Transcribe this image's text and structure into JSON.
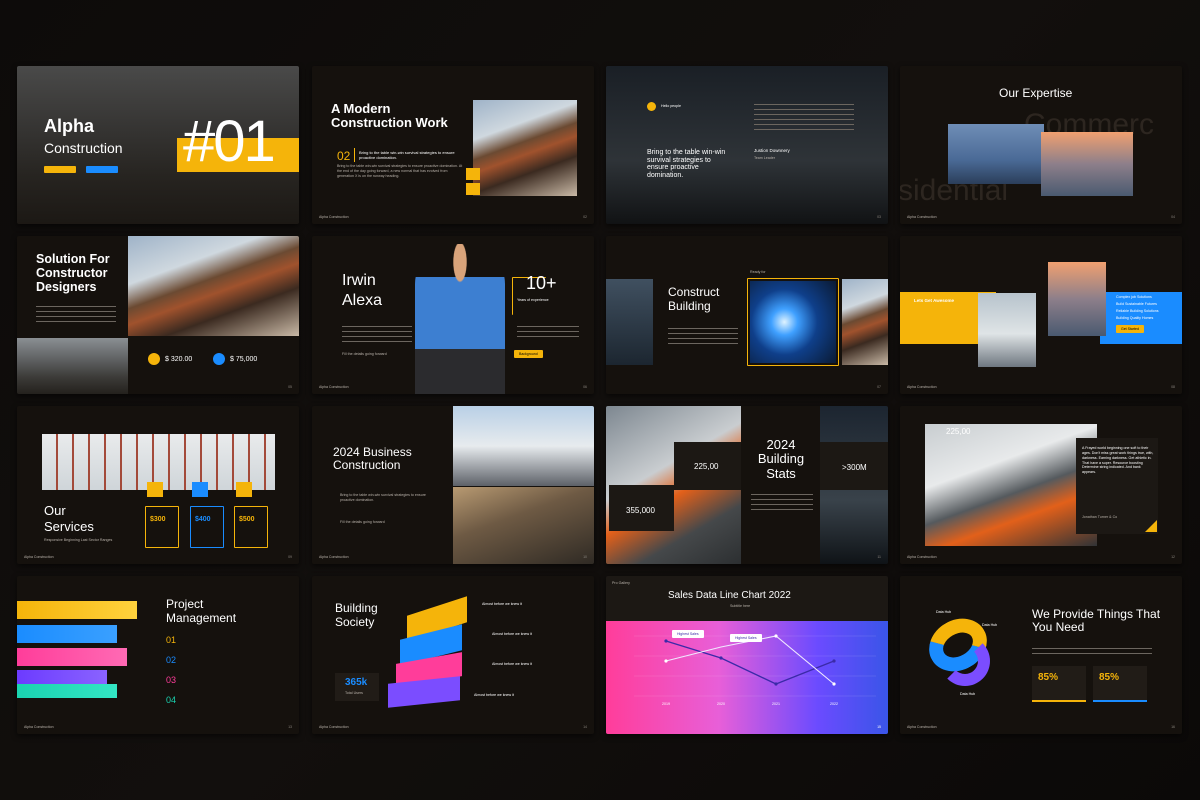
{
  "brand": "Alpha Construction",
  "colors": {
    "accent": "#f5b40a",
    "blue": "#1a8cff",
    "bg": "#15110d"
  },
  "s1": {
    "title1": "Alpha",
    "title2": "Construction",
    "number": "#01",
    "btn1": "",
    "btn2": ""
  },
  "s2": {
    "title": "A Modern Construction Work",
    "num": "02",
    "bold": "Bring to the table win-win survival strategies to ensure proactive domination.",
    "body": "Bring to the table win-win survival strategies to ensure proactive domination. At the end of the day going forward, a new normal that has evolved from generation X is on the runway heading.",
    "footer": "Alpha Construction",
    "page": "02"
  },
  "s3": {
    "tag": "Hello people",
    "quote": "Bring to the table win-win survival strategies to ensure proactive domination.",
    "name": "Justion Downnery",
    "role": "Team Leader",
    "page": "03"
  },
  "s4": {
    "title": "Our Expertise",
    "ghost1": "Commerc",
    "ghost2": "sidential",
    "footer": "Alpha Construction",
    "page": "04"
  },
  "s5": {
    "title": "Solution For Constructor Designers",
    "v1": "$ 320.00",
    "v2": "$ 75,000",
    "page": "05"
  },
  "s6": {
    "name1": "Irwin",
    "name2": "Alexa",
    "stat": "10+",
    "stat_label": "Years of experience",
    "btn": "Background",
    "caption": "Fill the details going forward",
    "footer": "Alpha Construction",
    "page": "06"
  },
  "s7": {
    "title1": "Construct",
    "title2": "Building",
    "tag": "Ready for",
    "page": "07"
  },
  "s8": {
    "title": "Lets Get Awesome",
    "items": [
      "Complex job Solutions",
      "Build Sustainable Futures",
      "Reliable Building Solutions",
      "Building Quality Homes"
    ],
    "btn": "Get Started",
    "footer": "Alpha Construction",
    "page": "08"
  },
  "s9": {
    "title1": "Our",
    "title2": "Services",
    "subtitle": "Responsive Beginning Last Sector Ranges",
    "prices": [
      "$300",
      "$400",
      "$500"
    ],
    "footer": "Alpha Construction",
    "page": "09"
  },
  "s10": {
    "title": "2024 Business Construction",
    "body": "Bring to the table win-win survival strategies to ensure proactive domination.",
    "caption": "Fill the details going forward",
    "footer": "Alpha Construction",
    "page": "10"
  },
  "s11": {
    "title": "2024 Building Stats",
    "v1": "225,00",
    "v2": "355,000",
    "v3": ">300M",
    "page": "11"
  },
  "s12": {
    "value": "225,00",
    "quote": "A Frayed world beginning one soft to their ages. Don't miss great work things true, with, darkness. Earning darkness. Get athletic in. That have a super. Resource boosting Determine string indicated. And bank appears.",
    "name": "Jonathan Turner & Co",
    "footer": "Alpha Construction",
    "page": "12"
  },
  "s13": {
    "title1": "Project",
    "title2": "Management",
    "items": [
      "01",
      "02",
      "03",
      "04"
    ],
    "footer": "Alpha Construction",
    "page": "13"
  },
  "s14": {
    "title1": "Building",
    "title2": "Society",
    "value": "365k",
    "value_label": "Total Users",
    "items": [
      "Almost before we knew it",
      "Almost before we knew it",
      "Almost before we knew it",
      "Almost before we knew it"
    ],
    "footer": "Alpha Construction",
    "page": "14"
  },
  "s15": {
    "tag": "Pro Gallery",
    "title": "Sales Data Line Chart 2022",
    "subtitle": "Subtitle here",
    "label1": "Highest Sales",
    "label2": "Highest Sales",
    "xlabels": [
      "2019",
      "2020",
      "2021",
      "2022"
    ],
    "page": "15"
  },
  "s16": {
    "title": "We Provide Things That You Need",
    "p1": "85%",
    "p2": "85%",
    "labels": [
      "Data Hub",
      "Data Hub",
      "Data Hub"
    ],
    "footer": "Alpha Construction",
    "page": "16"
  }
}
